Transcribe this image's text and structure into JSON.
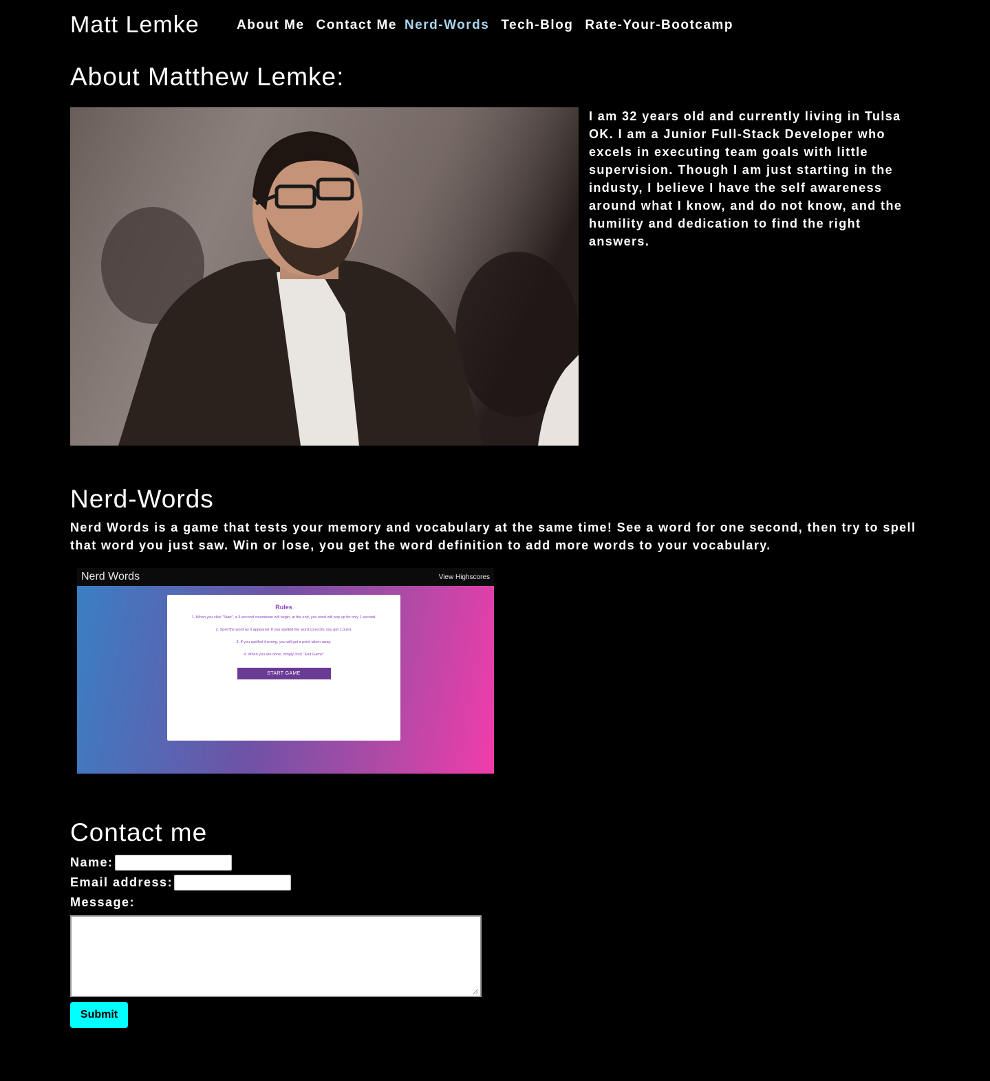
{
  "header": {
    "site_title": "Matt Lemke",
    "nav": [
      {
        "label": "About Me"
      },
      {
        "label": "Contact Me"
      },
      {
        "label": "Nerd-Words"
      },
      {
        "label": "Tech-Blog"
      },
      {
        "label": "Rate-Your-Bootcamp"
      }
    ],
    "active_nav_color": "#a9d7ef"
  },
  "about": {
    "title": "About Matthew Lemke:",
    "text": "I am 32 years old and currently living in Tulsa OK. I am a Junior Full-Stack Developer who excels in executing team goals with little supervision. Though I am just starting in the industy, I believe I have the self awareness around what I know, and do not know, and the humility and dedication to find the right answers."
  },
  "nerd_words": {
    "title": "Nerd-Words",
    "text": "Nerd Words is a game that tests your memory and vocabulary at the same time! See a word for one second, then try to spell that word you just saw. Win or lose, you get the word definition to add more words to your vocabulary.",
    "screenshot": {
      "brand": "Nerd Words",
      "link": "View Highscores",
      "rules_title": "Rules",
      "rules": [
        "1. When you click \"Start\", a 3-second countdown will begin, at the end, you word will pop up for only 1 second.",
        "2. Spell the word as it appeared. If you spelled the word correctly, you get 1 point.",
        "3. If you spelled it wrong, you will get a point taken away.",
        "4. When you are done, simply click \"End Game\""
      ],
      "start_button": "START GAME"
    }
  },
  "contact": {
    "title": "Contact me",
    "name_label": "Name:",
    "email_label": "Email address:",
    "message_label": "Message:",
    "submit_label": "Submit",
    "submit_color": "#00ffff"
  }
}
